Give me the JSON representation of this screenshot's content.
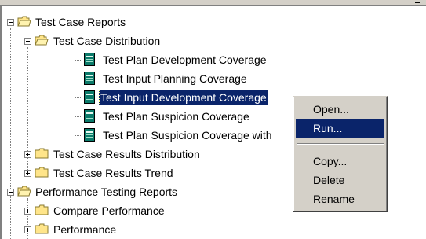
{
  "tree": {
    "nodes": [
      {
        "label": "Test Case Reports",
        "expander": "minus",
        "icon": "folder-open-icon"
      },
      {
        "label": "Test Case Distribution",
        "expander": "minus",
        "icon": "folder-open-icon"
      },
      {
        "label": "Test Plan Development Coverage",
        "icon": "report-icon"
      },
      {
        "label": "Test Input Planning Coverage",
        "icon": "report-icon"
      },
      {
        "label": "Test Input Development Coverage",
        "icon": "report-icon",
        "selected": true
      },
      {
        "label": "Test Plan Suspicion Coverage",
        "icon": "report-icon"
      },
      {
        "label": "Test Plan Suspicion Coverage with",
        "icon": "report-icon"
      },
      {
        "label": "Test Case Results Distribution",
        "expander": "plus",
        "icon": "folder-icon"
      },
      {
        "label": "Test Case Results Trend",
        "expander": "plus",
        "icon": "folder-icon"
      },
      {
        "label": "Performance Testing Reports",
        "expander": "minus",
        "icon": "folder-open-icon"
      },
      {
        "label": "Compare Performance",
        "expander": "plus",
        "icon": "folder-icon"
      },
      {
        "label": "Performance",
        "expander": "plus",
        "icon": "folder-icon"
      }
    ]
  },
  "context_menu": {
    "items": [
      "Open...",
      "Run...",
      "Copy...",
      "Delete",
      "Rename"
    ],
    "highlighted": "Run..."
  },
  "colors": {
    "selection": "#0a246a",
    "folder": "#ffe58a",
    "report": "#0b7a6a",
    "menu_bg": "#d4d0c8"
  }
}
